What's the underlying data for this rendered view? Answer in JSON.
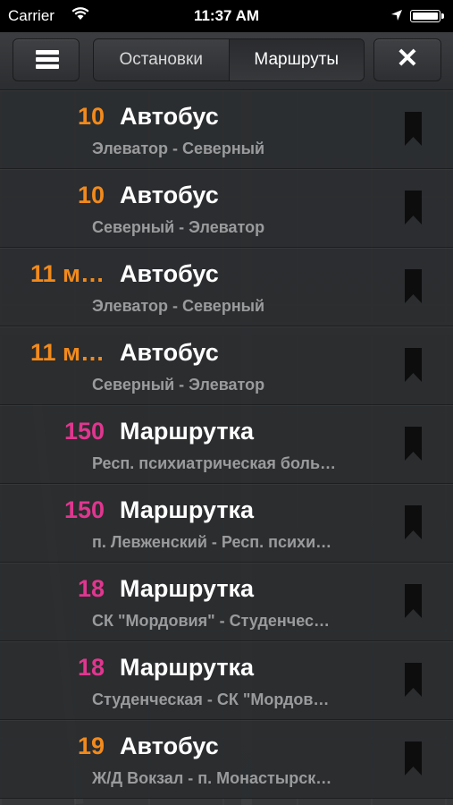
{
  "status_bar": {
    "carrier": "Carrier",
    "time": "11:37 AM"
  },
  "toolbar": {
    "segments": [
      "Остановки",
      "Маршруты"
    ],
    "selected_segment": "Маршруты"
  },
  "colors": {
    "bus": "#f28a1c",
    "minibus": "#e0368f"
  },
  "routes": [
    {
      "number": "10",
      "type": "Автобус",
      "path": "Элеватор - Северный",
      "color": "#f28a1c"
    },
    {
      "number": "10",
      "type": "Автобус",
      "path": "Северный - Элеватор",
      "color": "#f28a1c"
    },
    {
      "number": "11 м…",
      "type": "Автобус",
      "path": "Элеватор - Северный",
      "color": "#f28a1c"
    },
    {
      "number": "11 м…",
      "type": "Автобус",
      "path": "Северный - Элеватор",
      "color": "#f28a1c"
    },
    {
      "number": "150",
      "type": "Маршрутка",
      "path": "Респ. психиатрическая боль…",
      "color": "#e0368f"
    },
    {
      "number": "150",
      "type": "Маршрутка",
      "path": "п. Левженский - Респ. психи…",
      "color": "#e0368f"
    },
    {
      "number": "18",
      "type": "Маршрутка",
      "path": "СК \"Мордовия\" - Студенчес…",
      "color": "#e0368f"
    },
    {
      "number": "18",
      "type": "Маршрутка",
      "path": "Студенческая - СК \"Мордов…",
      "color": "#e0368f"
    },
    {
      "number": "19",
      "type": "Автобус",
      "path": "Ж/Д Вокзал - п. Монастырск…",
      "color": "#f28a1c"
    }
  ]
}
